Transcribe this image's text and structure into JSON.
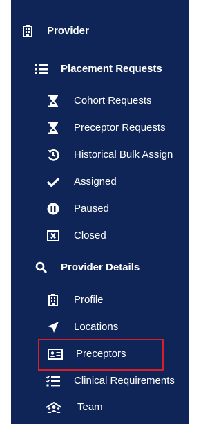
{
  "sidebar": {
    "provider": {
      "label": "Provider",
      "icon": "building-icon"
    },
    "placement_requests": {
      "label": "Placement Requests",
      "icon": "list-icon",
      "items": [
        {
          "label": "Cohort Requests",
          "icon": "hourglass-icon"
        },
        {
          "label": "Preceptor Requests",
          "icon": "hourglass-icon"
        },
        {
          "label": "Historical Bulk Assign",
          "icon": "history-icon"
        },
        {
          "label": "Assigned",
          "icon": "checkmark-icon"
        },
        {
          "label": "Paused",
          "icon": "pause-icon"
        },
        {
          "label": "Closed",
          "icon": "close-box-icon"
        }
      ]
    },
    "provider_details": {
      "label": "Provider Details",
      "icon": "search-icon",
      "items": [
        {
          "label": "Profile",
          "icon": "building-icon"
        },
        {
          "label": "Locations",
          "icon": "location-arrow-icon"
        },
        {
          "label": "Preceptors",
          "icon": "id-card-icon"
        },
        {
          "label": "Clinical Requirements",
          "icon": "checklist-icon"
        },
        {
          "label": "Team",
          "icon": "team-icon"
        }
      ]
    }
  },
  "colors": {
    "sidebar_bg": "#0f2557",
    "text": "#ffffff",
    "highlight_border": "#d61f26"
  }
}
